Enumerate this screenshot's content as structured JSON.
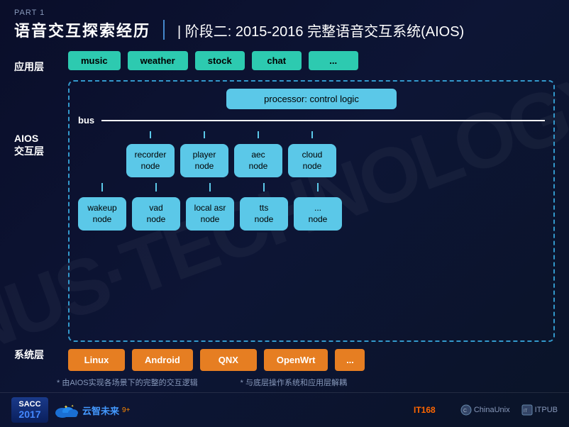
{
  "header": {
    "part_label": "PART 1",
    "main_title": "语音交互探索经历",
    "subtitle": "| 阶段二: 2015-2016 完整语音交互系统(AIOS)"
  },
  "diagram": {
    "layers": {
      "app_label": "应用层",
      "aios_label_line1": "AIOS",
      "aios_label_line2": "交互层",
      "sys_label": "系统层"
    },
    "app_boxes": [
      {
        "label": "music"
      },
      {
        "label": "weather"
      },
      {
        "label": "stock"
      },
      {
        "label": "chat"
      },
      {
        "label": "..."
      }
    ],
    "processor": {
      "label": "processor: control logic"
    },
    "bus": {
      "label": "bus"
    },
    "upper_nodes": [
      {
        "label": "recorder\nnode"
      },
      {
        "label": "player\nnode"
      },
      {
        "label": "aec\nnode"
      },
      {
        "label": "cloud\nnode"
      }
    ],
    "lower_nodes": [
      {
        "label": "wakeup\nnode"
      },
      {
        "label": "vad\nnode"
      },
      {
        "label": "local asr\nnode"
      },
      {
        "label": "tts\nnode"
      },
      {
        "label": "...\nnode"
      }
    ],
    "sys_boxes": [
      {
        "label": "Linux"
      },
      {
        "label": "Android"
      },
      {
        "label": "QNX"
      },
      {
        "label": "OpenWrt"
      },
      {
        "label": "..."
      }
    ]
  },
  "footer": {
    "note1": "* 由AIOS实现各场景下的完整的交互逻辑",
    "note2": "* 与底层操作系统和应用层解耦"
  },
  "bottom_bar": {
    "sacc": "SACC",
    "year": "2017",
    "cloud_text": "云智未来",
    "superscript": "9+",
    "sponsors": [
      {
        "label": "IT168",
        "class": "it168"
      },
      {
        "label": "ChinaUnix",
        "class": "chinaunix"
      },
      {
        "label": "ITPUB",
        "class": "itpub"
      }
    ]
  },
  "watermark": "NUS·TECHNOLOGY"
}
